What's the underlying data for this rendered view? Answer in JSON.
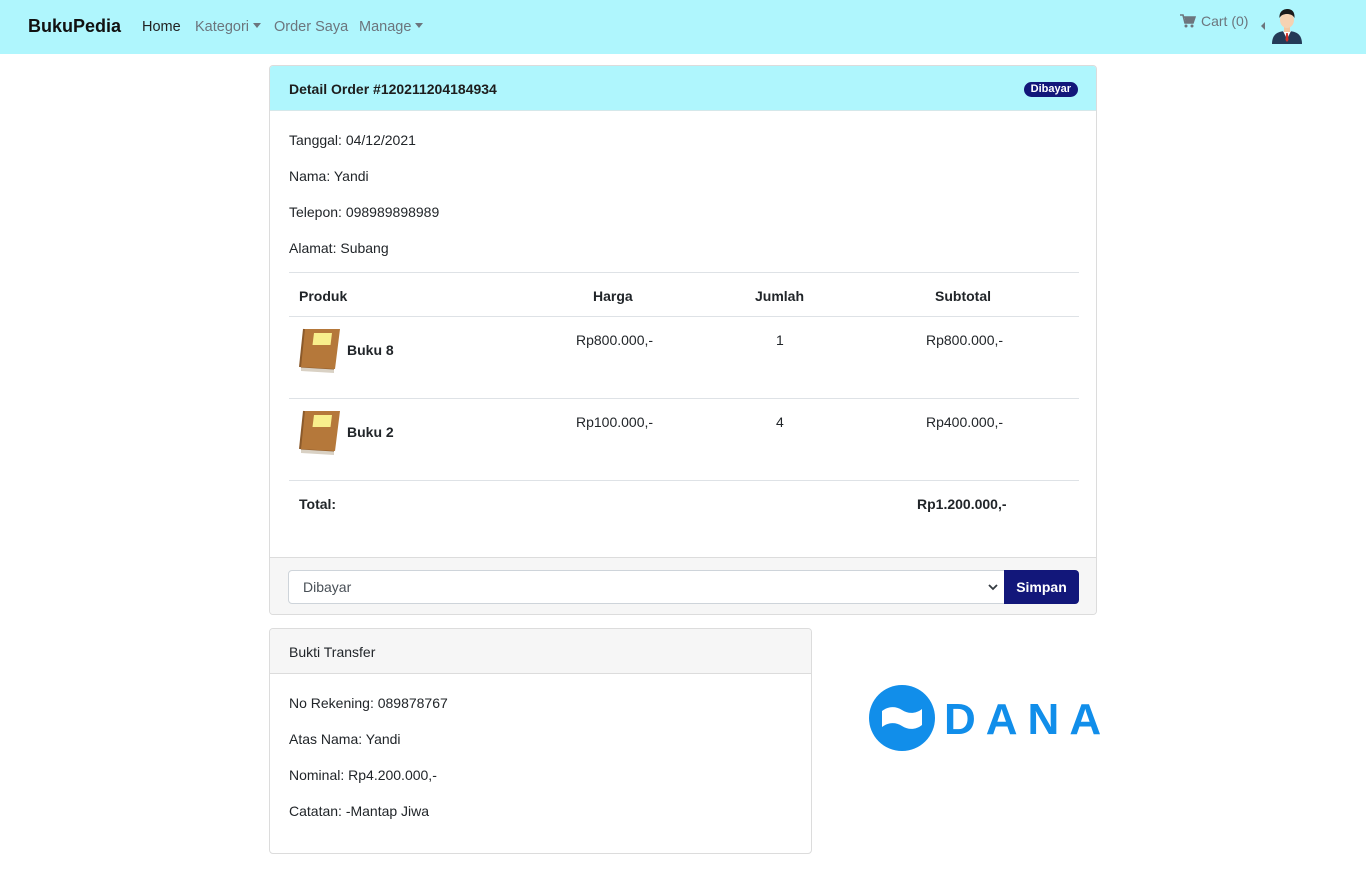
{
  "navbar": {
    "brand": "BukuPedia",
    "links": [
      "Home",
      "Kategori",
      "Order Saya",
      "Manage"
    ],
    "cart_label": "Cart (0)"
  },
  "order": {
    "title": "Detail Order #120211204184934",
    "status_badge": "Dibayar",
    "tanggal": "Tanggal: 04/12/2021",
    "nama": "Nama: Yandi",
    "telepon": "Telepon: 098989898989",
    "alamat": "Alamat: Subang",
    "table": {
      "headers": [
        "Produk",
        "Harga",
        "Jumlah",
        "Subtotal"
      ],
      "rows": [
        {
          "produk": "Buku 8",
          "harga": "Rp800.000,-",
          "jumlah": "1",
          "subtotal": "Rp800.000,-"
        },
        {
          "produk": "Buku 2",
          "harga": "Rp100.000,-",
          "jumlah": "4",
          "subtotal": "Rp400.000,-"
        }
      ],
      "total_label": "Total:",
      "total_value": "Rp1.200.000,-"
    },
    "status_select_value": "Dibayar",
    "save_label": "Simpan"
  },
  "transfer": {
    "title": "Bukti Transfer",
    "rekening": "No Rekening: 089878767",
    "atas_nama": "Atas Nama: Yandi",
    "nominal": "Nominal: Rp4.200.000,-",
    "catatan": "Catatan: -Mantap Jiwa"
  },
  "logo": {
    "text": "DANA",
    "color": "#118eea"
  },
  "colors": {
    "navbar_bg": "#aff6fd",
    "primary": "#12177a"
  }
}
